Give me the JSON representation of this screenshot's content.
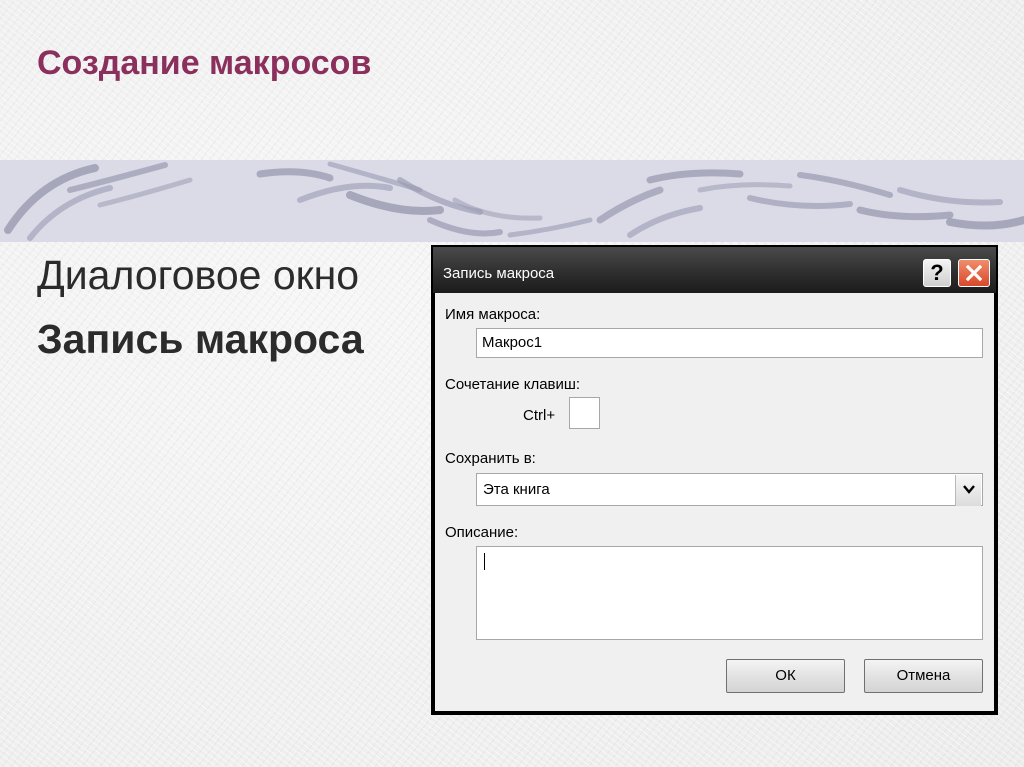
{
  "slide": {
    "title": "Создание макросов",
    "subtitle": "Диалоговое окно",
    "subtitle_bold": "Запись макроса"
  },
  "dialog": {
    "title": "Запись макроса",
    "help_label": "?",
    "macro_name_label": "Имя макроса:",
    "macro_name_value": "Макрос1",
    "shortcut_label": "Сочетание клавиш:",
    "ctrl_label": "Ctrl+",
    "shortcut_value": "",
    "save_in_label": "Сохранить в:",
    "save_in_value": "Эта книга",
    "description_label": "Описание:",
    "description_value": "",
    "ok_label": "ОК",
    "cancel_label": "Отмена"
  },
  "colors": {
    "title": "#8b2f5c",
    "band": "#dadbe7",
    "band_strokes": "#9a9ab2",
    "close_button": "#d8492a"
  },
  "icons": [
    "help-icon",
    "close-icon",
    "dropdown-arrow-icon"
  ]
}
